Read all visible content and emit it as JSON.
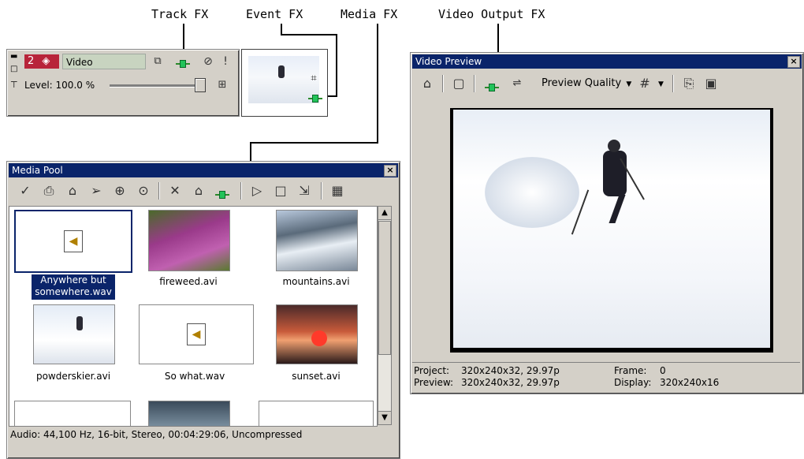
{
  "callouts": {
    "track_fx": "Track FX",
    "event_fx": "Event FX",
    "media_fx": "Media FX",
    "video_output_fx": "Video Output FX"
  },
  "track_header": {
    "track_number": "2",
    "track_name": "Video",
    "level_label": "Level: 100.0 %",
    "level_percent": 100
  },
  "media_pool": {
    "title": "Media Pool",
    "close_label": "×",
    "items": [
      {
        "name": "Anywhere but somewhere.wav",
        "name_line1": "Anywhere but",
        "name_line2": "somewhere.wav",
        "kind": "audio",
        "selected": true
      },
      {
        "name": "fireweed.avi",
        "kind": "video-fireweed"
      },
      {
        "name": "mountains.avi",
        "kind": "video-mountains"
      },
      {
        "name": "powderskier.avi",
        "kind": "video-skier"
      },
      {
        "name": "So what.wav",
        "kind": "audio"
      },
      {
        "name": "sunset.avi",
        "kind": "video-sunset"
      }
    ],
    "status": "Audio: 44,100 Hz, 16-bit, Stereo, 00:04:29:06, Uncompressed"
  },
  "video_preview": {
    "title": "Video Preview",
    "close_label": "×",
    "preview_quality_label": "Preview Quality",
    "project_label": "Project:",
    "project_value": "320x240x32, 29.97p",
    "preview_label": "Preview:",
    "preview_value": "320x240x32, 29.97p",
    "frame_label": "Frame:",
    "frame_value": "0",
    "display_label": "Display:",
    "display_value": "320x240x16"
  },
  "colors": {
    "title_bar": "#0a246a",
    "fx_green": "#22c35a",
    "window_face": "#d4d0c8"
  }
}
